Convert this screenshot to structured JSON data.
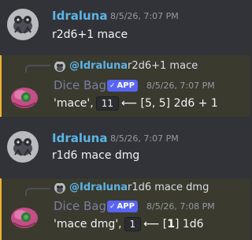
{
  "messages": [
    {
      "author": "Idraluna",
      "timestamp": "8/5/26, 7:07 PM",
      "text": "r2d6+1 mace"
    },
    {
      "reply": {
        "author": "@Idraluna",
        "text": "r2d6+1 mace"
      },
      "author": "Dice Bag",
      "badge": "APP",
      "badge_check": "✓",
      "timestamp": "8/5/26, 7:07 PM",
      "result_label": "'mace',",
      "total": "11",
      "arrow": "⟵",
      "rolls": "[5, 5] 2d6 + 1"
    },
    {
      "author": "Idraluna",
      "timestamp": "8/5/26, 7:07 PM",
      "text": "r1d6 mace dmg"
    },
    {
      "reply": {
        "author": "@Idraluna",
        "text": "r1d6 mace dmg"
      },
      "author": "Dice Bag",
      "badge": "APP",
      "badge_check": "✓",
      "timestamp": "8/5/26, 7:08 PM",
      "result_label": "'mace dmg',",
      "total": "1",
      "arrow": "⟵",
      "rolls_open": "[",
      "rolls_bold": "1",
      "rolls_close": "] 1d6"
    }
  ],
  "colors": {
    "background": "#313338",
    "user_name": "#5cb4e6",
    "highlight_bg": "#3a3a2f",
    "highlight_bar": "#f0b232",
    "app_badge": "#5865f2"
  }
}
